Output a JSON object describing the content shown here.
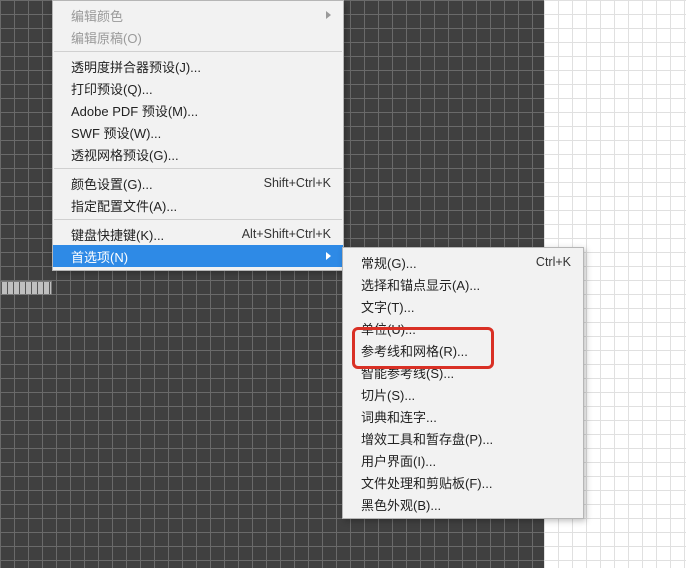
{
  "menu1": {
    "items": [
      {
        "label": "编辑颜色",
        "disabled": true,
        "arrow": true
      },
      {
        "label": "编辑原稿(O)",
        "disabled": true
      },
      {
        "sep": true
      },
      {
        "label": "透明度拼合器预设(J)..."
      },
      {
        "label": "打印预设(Q)..."
      },
      {
        "label": "Adobe PDF 预设(M)..."
      },
      {
        "label": "SWF 预设(W)..."
      },
      {
        "label": "透视网格预设(G)..."
      },
      {
        "sep": true
      },
      {
        "label": "颜色设置(G)...",
        "shortcut": "Shift+Ctrl+K"
      },
      {
        "label": "指定配置文件(A)..."
      },
      {
        "sep": true
      },
      {
        "label": "键盘快捷键(K)...",
        "shortcut": "Alt+Shift+Ctrl+K"
      },
      {
        "label": "首选项(N)",
        "arrow": true,
        "highlight": true
      }
    ]
  },
  "menu2": {
    "items": [
      {
        "label": "常规(G)...",
        "shortcut": "Ctrl+K"
      },
      {
        "label": "选择和锚点显示(A)..."
      },
      {
        "label": "文字(T)..."
      },
      {
        "label": "单位(U)..."
      },
      {
        "label": "参考线和网格(R)..."
      },
      {
        "label": "智能参考线(S)..."
      },
      {
        "label": "切片(S)..."
      },
      {
        "label": "词典和连字..."
      },
      {
        "label": "增效工具和暂存盘(P)..."
      },
      {
        "label": "用户界面(I)..."
      },
      {
        "label": "文件处理和剪贴板(F)..."
      },
      {
        "label": "黑色外观(B)..."
      }
    ]
  }
}
